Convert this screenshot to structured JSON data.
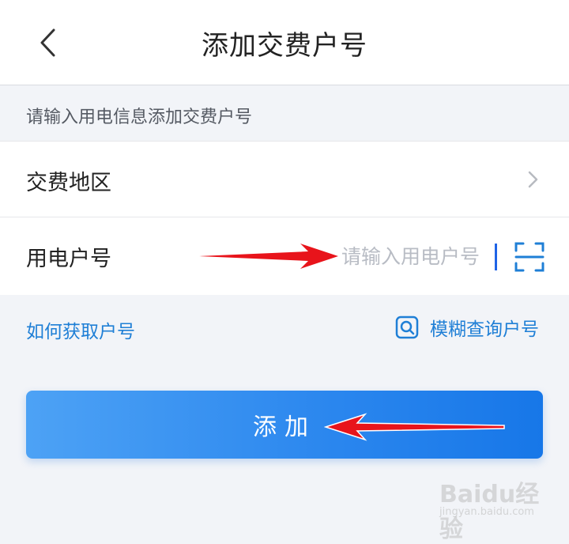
{
  "header": {
    "title": "添加交费户号",
    "back_icon": "chevron-left-icon"
  },
  "hint": "请输入用电信息添加交费户号",
  "form": {
    "region": {
      "label": "交费地区",
      "icon": "chevron-right-icon"
    },
    "account": {
      "label": "用电户号",
      "value": "",
      "placeholder": "请输入用电户号",
      "scan_icon": "scan-icon"
    }
  },
  "links": {
    "how_to_get": "如何获取户号",
    "fuzzy_search": "模糊查询户号",
    "fuzzy_search_icon": "search-icon"
  },
  "add_button": {
    "label": "添加"
  },
  "watermark": {
    "logo": "Baidu经验",
    "site": "jingyan.baidu.com"
  },
  "colors": {
    "accent": "#1f7fd6",
    "button_start": "#4da2f5",
    "button_end": "#1777e8",
    "annotation_arrow": "#e8141b"
  }
}
